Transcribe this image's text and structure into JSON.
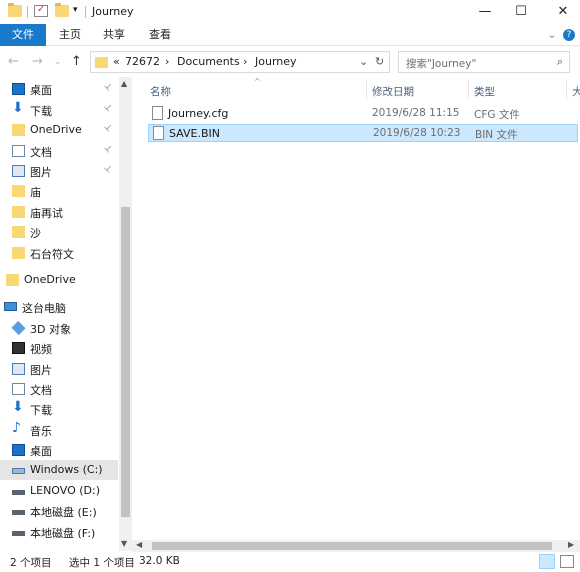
{
  "title": "Journey",
  "window_controls": {
    "minimize": "—",
    "maximize": "☐",
    "close": "✕"
  },
  "ribbon": {
    "tabs": [
      "文件",
      "主页",
      "共享",
      "查看"
    ],
    "expand": "⌄",
    "help": "?"
  },
  "address": {
    "back": "←",
    "forward": "→",
    "up": "↑",
    "overflow": "«",
    "crumbs": [
      "72672",
      "Documents",
      "Journey"
    ],
    "sep": "›",
    "dropdown": "⌄",
    "refresh": "↻",
    "search_placeholder": "搜索\"Journey\""
  },
  "nav": {
    "items": [
      {
        "label": "桌面",
        "pinned": true
      },
      {
        "label": "下载",
        "pinned": true
      },
      {
        "label": "OneDrive",
        "pinned": true
      },
      {
        "label": "文档",
        "pinned": true
      },
      {
        "label": "图片",
        "pinned": true
      },
      {
        "label": "庙",
        "pinned": false
      },
      {
        "label": "庙再试",
        "pinned": false
      },
      {
        "label": "沙",
        "pinned": false
      },
      {
        "label": "石台符文",
        "pinned": false
      },
      {
        "label": "OneDrive",
        "pinned": false
      },
      {
        "label": "这台电脑",
        "pinned": false
      },
      {
        "label": "3D 对象",
        "pinned": false
      },
      {
        "label": "视频",
        "pinned": false
      },
      {
        "label": "图片",
        "pinned": false
      },
      {
        "label": "文档",
        "pinned": false
      },
      {
        "label": "下载",
        "pinned": false
      },
      {
        "label": "音乐",
        "pinned": false
      },
      {
        "label": "桌面",
        "pinned": false
      },
      {
        "label": "Windows (C:)",
        "pinned": false
      },
      {
        "label": "LENOVO (D:)",
        "pinned": false
      },
      {
        "label": "本地磁盘 (E:)",
        "pinned": false
      },
      {
        "label": "本地磁盘 (F:)",
        "pinned": false
      }
    ],
    "pin_glyph": "📌"
  },
  "files": {
    "columns": [
      "名称",
      "修改日期",
      "类型",
      "大"
    ],
    "rows": [
      {
        "name": "Journey.cfg",
        "date": "2019/6/28 11:15",
        "type": "CFG 文件"
      },
      {
        "name": "SAVE.BIN",
        "date": "2019/6/28 10:23",
        "type": "BIN 文件"
      }
    ]
  },
  "status": {
    "item_count": "2 个项目",
    "selection": "选中 1 个项目",
    "size": "32.0 KB"
  }
}
